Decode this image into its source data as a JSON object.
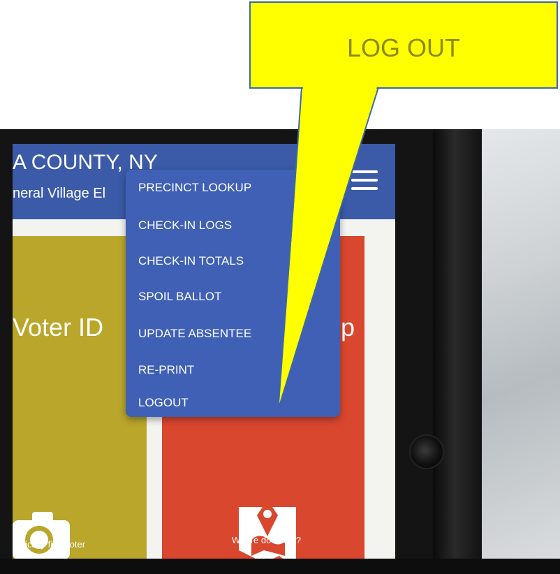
{
  "app": {
    "county_title": "A COUNTY, NY",
    "election_title": "neral Village El"
  },
  "header": {
    "menu_icon": "hamburger-icon",
    "background_color": "#3b5aa8"
  },
  "tiles": [
    {
      "title": "Voter ID",
      "caption": "natically find voter",
      "icon": "camera-icon",
      "color": "#b9a62a"
    },
    {
      "title": "p",
      "caption": "Where do I vote?",
      "icon": "map-pin-icon",
      "color": "#d9472f"
    }
  ],
  "menu": {
    "items": [
      {
        "label": "PRECINCT LOOKUP"
      },
      {
        "label": "CHECK-IN LOGS"
      },
      {
        "label": "CHECK-IN TOTALS"
      },
      {
        "label": "SPOIL BALLOT"
      },
      {
        "label": "UPDATE ABSENTEE"
      },
      {
        "label": "RE-PRINT"
      },
      {
        "label": "LOGOUT"
      }
    ],
    "background_color": "#3f60b5"
  },
  "callout": {
    "label": "LOG OUT",
    "color": "#ffff00"
  }
}
